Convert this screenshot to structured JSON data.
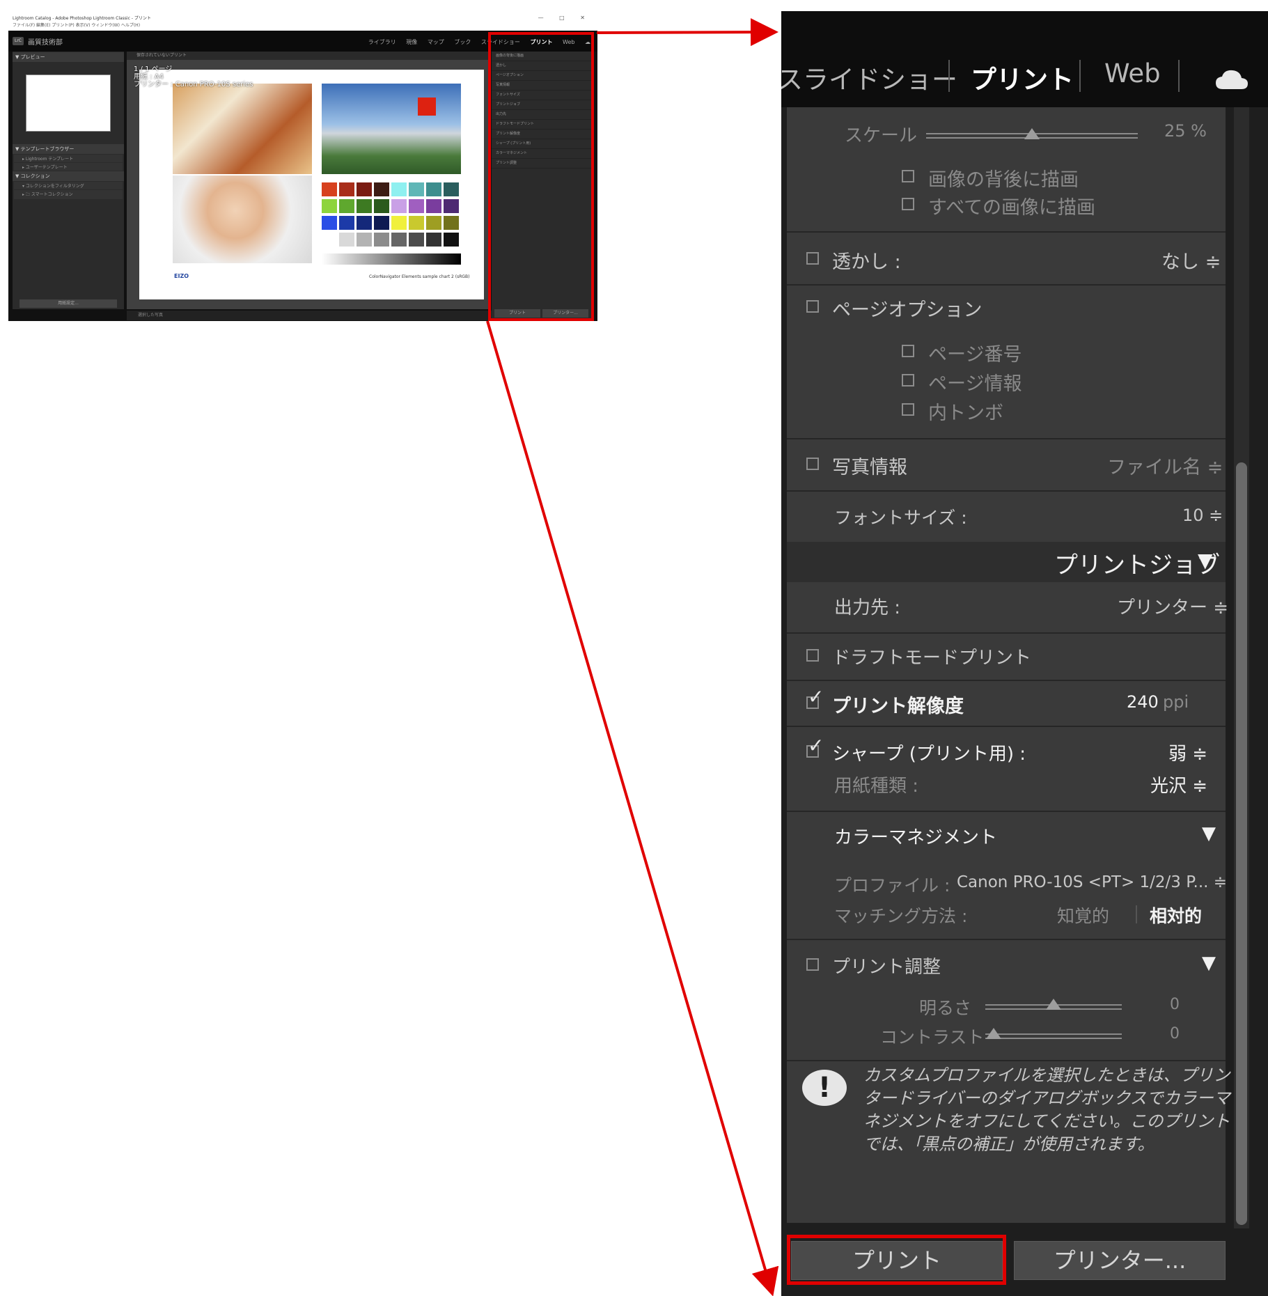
{
  "mini": {
    "title": "Lightroom Catalog - Adobe Photoshop Lightroom Classic - プリント",
    "menu": "ファイル(F)  編集(E)  プリント(P)  表示(V)  ウィンドウ(W)  ヘルプ(H)",
    "window_controls": "—  □  ✕",
    "badge": "LrC",
    "identity": "画質技術部",
    "modules": [
      "ライブラリ",
      "現像",
      "マップ",
      "ブック",
      "スライドショー",
      "プリント",
      "Web"
    ],
    "left_panel": {
      "preview_header": "▼ プレビュー",
      "template_header": "▼ テンプレートブラウザー",
      "template_items": [
        "▸ Lightroom テンプレート",
        "▸ ユーザーテンプレート"
      ],
      "collection_header": "▼ コレクション",
      "collection_items": [
        "▾ コレクションをフィルタリング",
        "▸ 🗀 スマートコレクション"
      ],
      "bottom_button": "用紙設定..."
    },
    "center": {
      "toolbar_text": "保存されていないプリント",
      "page_info": [
        "1 / 1 ページ",
        "用紙 : A4",
        "プリンター : Canon PRO-10S series"
      ],
      "logo": "EIZO",
      "caption": "ColorNavigator Elements sample chart 2 (sRGB)",
      "filmstrip": "選択した写真"
    },
    "right_panel_rows": [
      "画像の背後に描画",
      "透かし",
      "ページオプション",
      "写真情報",
      "フォントサイズ",
      "プリントジョブ",
      "出力先",
      "ドラフトモードプリント",
      "プリント解像度",
      "シャープ (プリント用)",
      "カラーマネジメント",
      "プリント調整"
    ],
    "right_buttons": [
      "プリント",
      "プリンター..."
    ]
  },
  "zoom": {
    "modules": {
      "slideshow": "スライドショー",
      "print": "プリント",
      "web": "Web"
    },
    "cloud_icon": "cloud-icon",
    "scale": {
      "label": "スケール",
      "value": "25 %",
      "level": 0.25
    },
    "draw_behind": "画像の背後に描画",
    "draw_all": "すべての画像に描画",
    "watermark": {
      "label": "透かし :",
      "value": "なし ≑"
    },
    "page_options": {
      "label": "ページオプション",
      "items": [
        "ページ番号",
        "ページ情報",
        "内トンボ"
      ]
    },
    "photo_info": {
      "label": "写真情報",
      "value": "ファイル名 ≑"
    },
    "font_size": {
      "label": "フォントサイズ :",
      "value": "10 ≑"
    },
    "print_job": {
      "header": "プリントジョブ",
      "arrow": "▼"
    },
    "output": {
      "label": "出力先 :",
      "value": "プリンター ≑"
    },
    "draft_mode": "ドラフトモードプリント",
    "resolution": {
      "label": "プリント解像度",
      "value": "240",
      "unit": "ppi"
    },
    "sharpen": {
      "label": "シャープ (プリント用) :",
      "value": "弱 ≑"
    },
    "media": {
      "label": "用紙種類 :",
      "value": "光沢 ≑"
    },
    "color_mgmt": {
      "header": "カラーマネジメント",
      "arrow": "▼"
    },
    "profile": {
      "label": "プロファイル :",
      "value": "Canon PRO-10S <PT> 1/2/3 P... ≑"
    },
    "intent": {
      "label": "マッチング方法 :",
      "options": [
        "知覚的",
        "相対的"
      ],
      "selected": "相対的"
    },
    "adjust": {
      "label": "プリント調整",
      "arrow": "▼"
    },
    "brightness": {
      "label": "明るさ",
      "value": "0",
      "level": 0.5
    },
    "contrast": {
      "label": "コントラスト",
      "value": "0",
      "level": 0.0
    },
    "warning_icon": "!",
    "warning_lines": [
      "カスタムプロファイルを選択したときは、プリン",
      "タードライバーのダイアログボックスでカラーマ",
      "ネジメントをオフにしてください。このプリント",
      "では、「黒点の補正」が使用されます。"
    ],
    "buttons": {
      "print": "プリント",
      "printer": "プリンター..."
    }
  },
  "colors": {
    "highlight": "#e00000",
    "panel": "#3a3a3a",
    "background": "#1e1e1e"
  }
}
